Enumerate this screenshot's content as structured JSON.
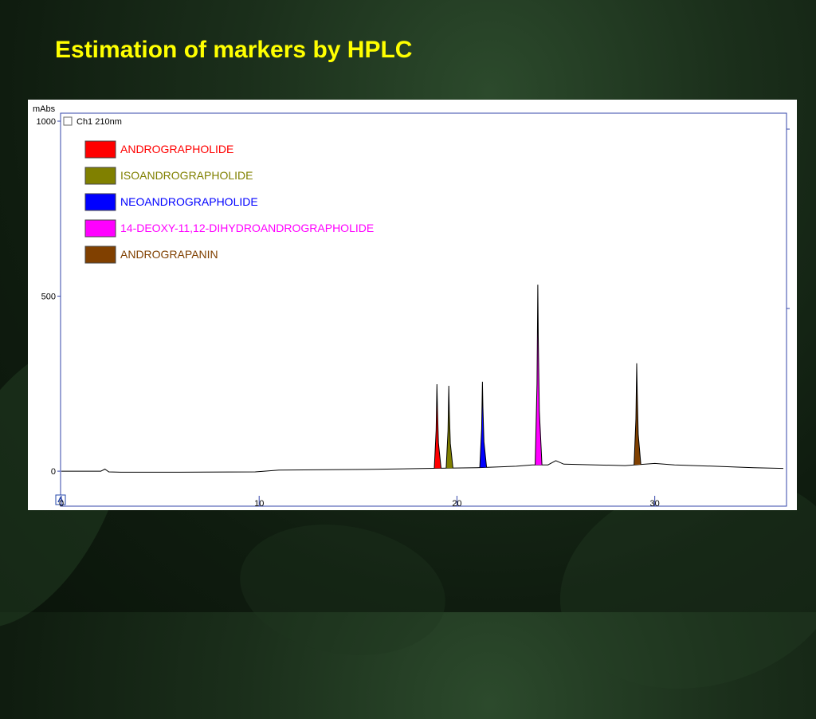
{
  "slide": {
    "title": "Estimation of markers by HPLC"
  },
  "chart_data": {
    "type": "line",
    "title": "",
    "xlabel": "",
    "ylabel": "mAbs",
    "xlim": [
      0,
      36.5
    ],
    "ylim": [
      -100,
      1000
    ],
    "x_ticks": [
      0,
      10,
      20,
      30
    ],
    "y_ticks": [
      0,
      500,
      1000
    ],
    "x_tick_labels": [
      "0",
      "10",
      "20",
      "30"
    ],
    "y_tick_labels": [
      "0",
      "500",
      "1000"
    ],
    "channel_label": "Ch1 210nm",
    "grid": false,
    "legend_position": "top-left",
    "line_color": "#000000",
    "baseline": [
      {
        "x": 0,
        "y": 0
      },
      {
        "x": 2,
        "y": 0
      },
      {
        "x": 2.2,
        "y": 6
      },
      {
        "x": 2.4,
        "y": -2
      },
      {
        "x": 3,
        "y": -3
      },
      {
        "x": 6,
        "y": -3
      },
      {
        "x": 9.8,
        "y": -2
      },
      {
        "x": 11,
        "y": 3
      },
      {
        "x": 15.5,
        "y": 5
      },
      {
        "x": 18.5,
        "y": 8
      },
      {
        "x": 21,
        "y": 10
      },
      {
        "x": 23,
        "y": 14
      },
      {
        "x": 23.8,
        "y": 18
      },
      {
        "x": 24.6,
        "y": 18
      },
      {
        "x": 25,
        "y": 30
      },
      {
        "x": 25.4,
        "y": 20
      },
      {
        "x": 27,
        "y": 18
      },
      {
        "x": 28.5,
        "y": 16
      },
      {
        "x": 30,
        "y": 22
      },
      {
        "x": 31,
        "y": 18
      },
      {
        "x": 33,
        "y": 14
      },
      {
        "x": 35,
        "y": 10
      },
      {
        "x": 36.5,
        "y": 8
      }
    ],
    "series": [
      {
        "name": "ANDROGRAPHOLIDE",
        "color": "#ff0000",
        "retention_time": 19.0,
        "height": 240
      },
      {
        "name": "ISOANDROGRAPHOLIDE",
        "color": "#808000",
        "retention_time": 19.6,
        "height": 235
      },
      {
        "name": "NEOANDROGRAPHOLIDE",
        "color": "#0000ff",
        "retention_time": 21.3,
        "height": 245
      },
      {
        "name": "14-DEOXY-11,12-DIHYDROANDROGRAPHOLIDE",
        "color": "#ff00ff",
        "retention_time": 24.1,
        "height": 515
      },
      {
        "name": "ANDROGRAPANIN",
        "color": "#804000",
        "retention_time": 29.1,
        "height": 290
      }
    ]
  }
}
